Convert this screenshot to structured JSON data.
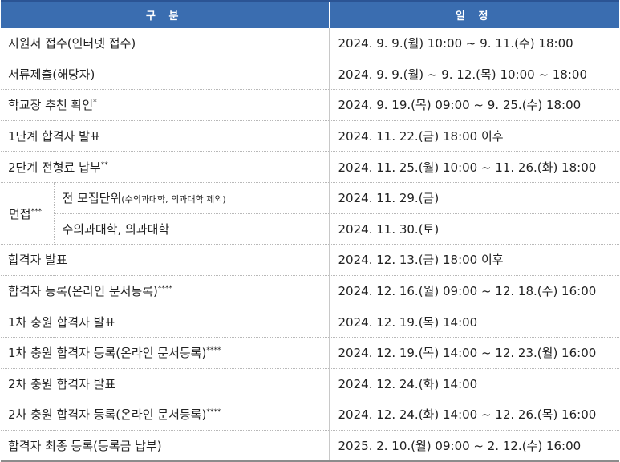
{
  "header": {
    "category": "구 분",
    "schedule": "일 정"
  },
  "rows": [
    {
      "label": "지원서 접수(인터넷 접수)",
      "date": "2024. 9. 9.(월) 10:00 ~ 9. 11.(수) 18:00"
    },
    {
      "label": "서류제출(해당자)",
      "date": "2024. 9. 9.(월) ~ 9. 12.(목) 10:00 ~ 18:00"
    },
    {
      "label": "학교장 추천 확인",
      "mark": "*",
      "date": "2024. 9. 19.(목) 09:00 ~ 9. 25.(수) 18:00"
    },
    {
      "label": "1단계 합격자 발표",
      "date": "2024. 11. 22.(금) 18:00 이후"
    },
    {
      "label": "2단계 전형료 납부",
      "mark": "**",
      "date": "2024. 11. 25.(월) 10:00 ~ 11. 26.(화) 18:00"
    }
  ],
  "interview": {
    "label": "면접",
    "mark": "***",
    "sub1": {
      "label": "전 모집단위",
      "note": "(수의과대학, 의과대학 제외)",
      "date": "2024. 11. 29.(금)"
    },
    "sub2": {
      "label": "수의과대학, 의과대학",
      "date": "2024. 11. 30.(토)"
    }
  },
  "rows2": [
    {
      "label": "합격자 발표",
      "date": "2024. 12. 13.(금) 18:00 이후"
    },
    {
      "label": "합격자 등록(온라인 문서등록)",
      "mark": "****",
      "date": "2024. 12. 16.(월) 09:00 ~ 12. 18.(수) 16:00"
    },
    {
      "label": "1차 충원 합격자 발표",
      "date": "2024. 12. 19.(목) 14:00"
    },
    {
      "label": "1차 충원 합격자 등록(온라인 문서등록)",
      "mark": "****",
      "date": "2024. 12. 19.(목) 14:00 ~ 12. 23.(월) 16:00"
    },
    {
      "label": "2차 충원 합격자 발표",
      "date": "2024. 12. 24.(화) 14:00"
    },
    {
      "label": "2차 충원 합격자 등록(온라인 문서등록)",
      "mark": "****",
      "date": "2024. 12. 24.(화) 14:00 ~ 12. 26.(목) 16:00"
    },
    {
      "label": "합격자 최종 등록(등록금 납부)",
      "date": "2025. 2. 10.(월) 09:00 ~ 2. 12.(수) 16:00"
    }
  ]
}
